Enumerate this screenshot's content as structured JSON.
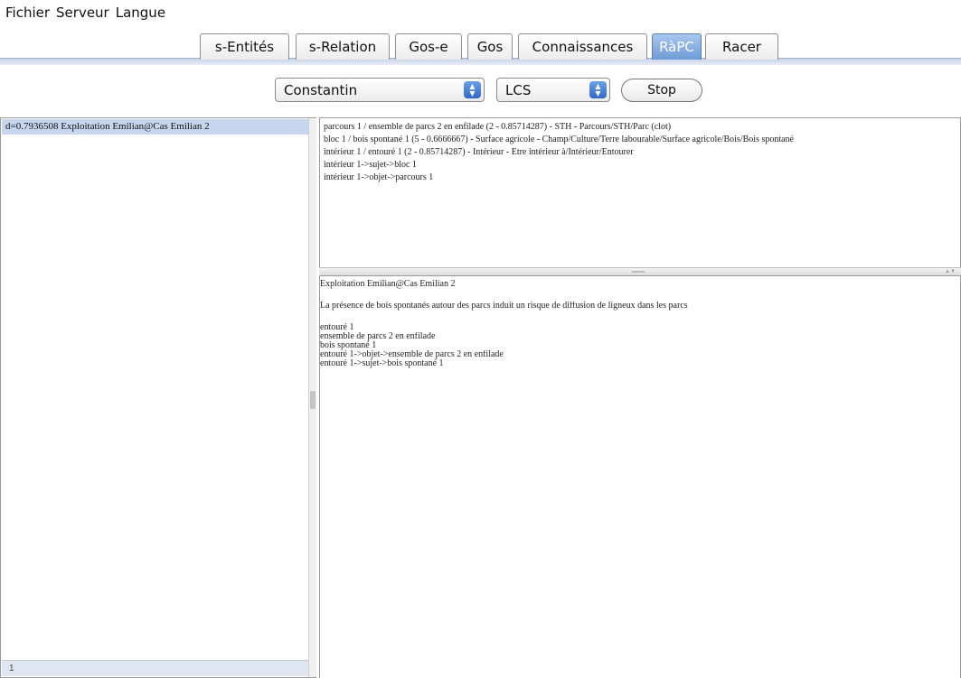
{
  "menu": {
    "items": [
      "Fichier",
      "Serveur",
      "Langue"
    ]
  },
  "tabs": [
    {
      "label": "s-Entités",
      "active": false
    },
    {
      "label": "s-Relation",
      "active": false
    },
    {
      "label": "Gos-e",
      "active": false
    },
    {
      "label": "Gos",
      "active": false
    },
    {
      "label": "Connaissances",
      "active": false
    },
    {
      "label": "RàPC",
      "active": true
    },
    {
      "label": "Racer",
      "active": false
    }
  ],
  "toolbar": {
    "user_select": "Constantin",
    "method_select": "LCS",
    "stop_label": "Stop"
  },
  "left_panel": {
    "items": [
      "d=0.7936508 Exploitation Emilian@Cas Emilian 2"
    ],
    "status": "1"
  },
  "right_top": {
    "lines": [
      "parcours 1 / ensemble de parcs 2 en enfilade (2 - 0.85714287) - STH - Parcours/STH/Parc (clot)",
      "bloc 1 / bois spontané 1 (5 - 0.6666667) - Surface agricole - Champ/Culture/Terre labourable/Surface agricole/Bois/Bois spontané",
      "intérieur 1 / entouré 1 (2 - 0.85714287) - Intérieur - Etre intérieur à/Intérieur/Entourer",
      "intérieur 1->sujet->bloc 1",
      "intérieur 1->objet->parcours 1"
    ]
  },
  "right_bottom": {
    "title": "Exploitation Emilian@Cas Emilian 2",
    "sentence": "La présence de bois spontanés autour des parcs induit un risque de diffusion de ligneux dans les parcs",
    "lines": [
      "entouré 1",
      "ensemble de parcs 2 en enfilade",
      "bois spontané 1",
      "entouré 1->objet->ensemble de parcs 2 en enfilade",
      "entouré 1->sujet->bois spontané 1"
    ]
  },
  "colors": {
    "active_tab": "#6f9bd6",
    "selection": "#c7d6ef",
    "select_arrow": "#2f68c6"
  },
  "icons": {
    "select_arrows": "up-down-chevron-icon"
  }
}
